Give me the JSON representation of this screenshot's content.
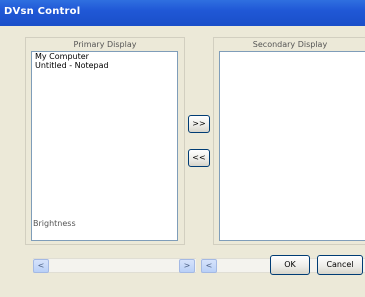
{
  "window": {
    "title": "DVsn Control"
  },
  "primary": {
    "label": "Primary Display",
    "items": [
      "My Computer",
      "Untitled - Notepad"
    ]
  },
  "secondary": {
    "label": "Secondary Display",
    "items": []
  },
  "move_buttons": {
    "right": ">>",
    "left": "<<"
  },
  "brightness": {
    "label": "Brightness"
  },
  "scroll_arrows": {
    "left": "<",
    "right": ">"
  },
  "dialog": {
    "ok": "OK",
    "cancel": "Cancel"
  },
  "colors": {
    "titlebar": "#2058d6",
    "face": "#ece9d8",
    "scroll_arrow": "#b9d0f7"
  }
}
